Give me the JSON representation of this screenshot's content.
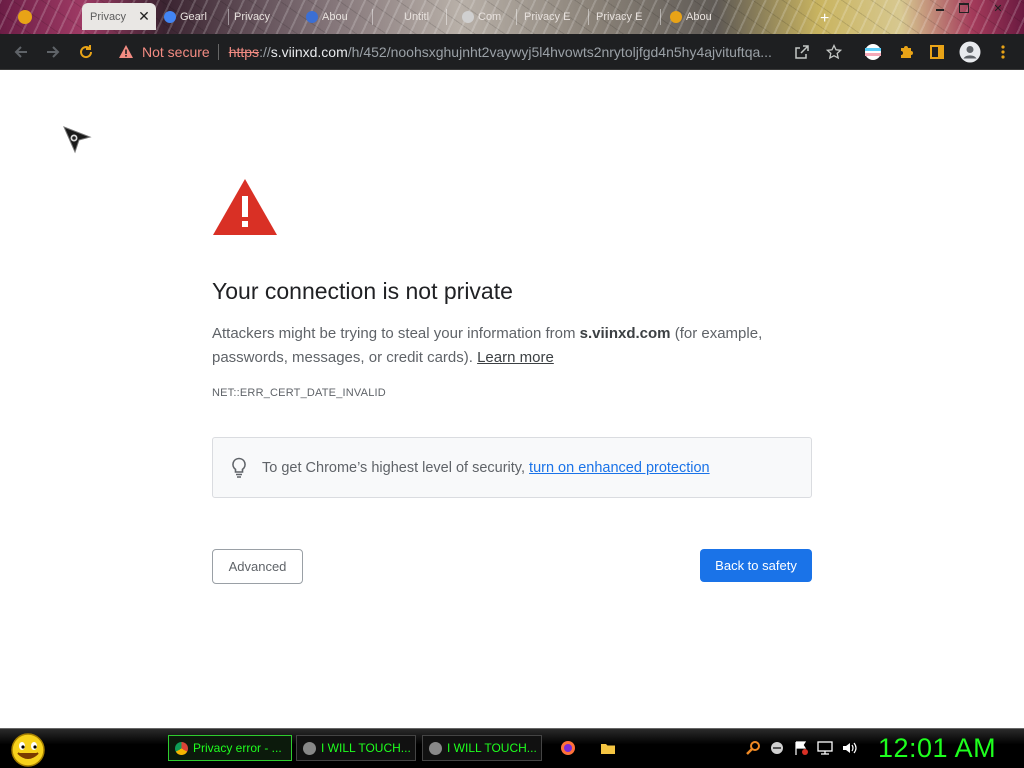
{
  "tabs": [
    {
      "label": "Privacy",
      "active": true
    },
    {
      "label": "Gearl",
      "active": false
    },
    {
      "label": "Privacy",
      "active": false
    },
    {
      "label": "Abou",
      "active": false
    },
    {
      "label": "Untitl",
      "active": false
    },
    {
      "label": "Com",
      "active": false
    },
    {
      "label": "Privacy E",
      "active": false
    },
    {
      "label": "Privacy E",
      "active": false
    },
    {
      "label": "Abou",
      "active": false
    }
  ],
  "tab_close": "✕",
  "omnibox": {
    "security_label": "Not secure",
    "url_scheme": "https",
    "url_sep": "://",
    "url_host": "s.viinxd.com",
    "url_path": "/h/452/noohsxghujnht2vaywyj5l4hvowts2nrytoljfgd4n5hy4ajvituftqa..."
  },
  "page": {
    "headline": "Your connection is not private",
    "desc_before": "Attackers might be trying to steal your information from ",
    "desc_host": "s.viinxd.com",
    "desc_after": " (for example, passwords, messages, or credit cards). ",
    "learn_more": "Learn more",
    "error_code": "NET::ERR_CERT_DATE_INVALID",
    "enhanced_prefix": "To get Chrome’s highest level of security, ",
    "enhanced_link": "turn on enhanced protection",
    "advanced_button": "Advanced",
    "safety_button": "Back to safety"
  },
  "taskbar": {
    "tasks": [
      {
        "label": "Privacy error - ...",
        "active": true
      },
      {
        "label": "I WILL TOUCH...",
        "active": false
      },
      {
        "label": "I WILL TOUCH...",
        "active": false
      }
    ],
    "clock": "12:01 AM"
  },
  "colors": {
    "primary_blue": "#1a73e8",
    "warning_red": "#d93025",
    "not_secure_red": "#f28b82",
    "taskbar_green": "#1eff1e"
  }
}
